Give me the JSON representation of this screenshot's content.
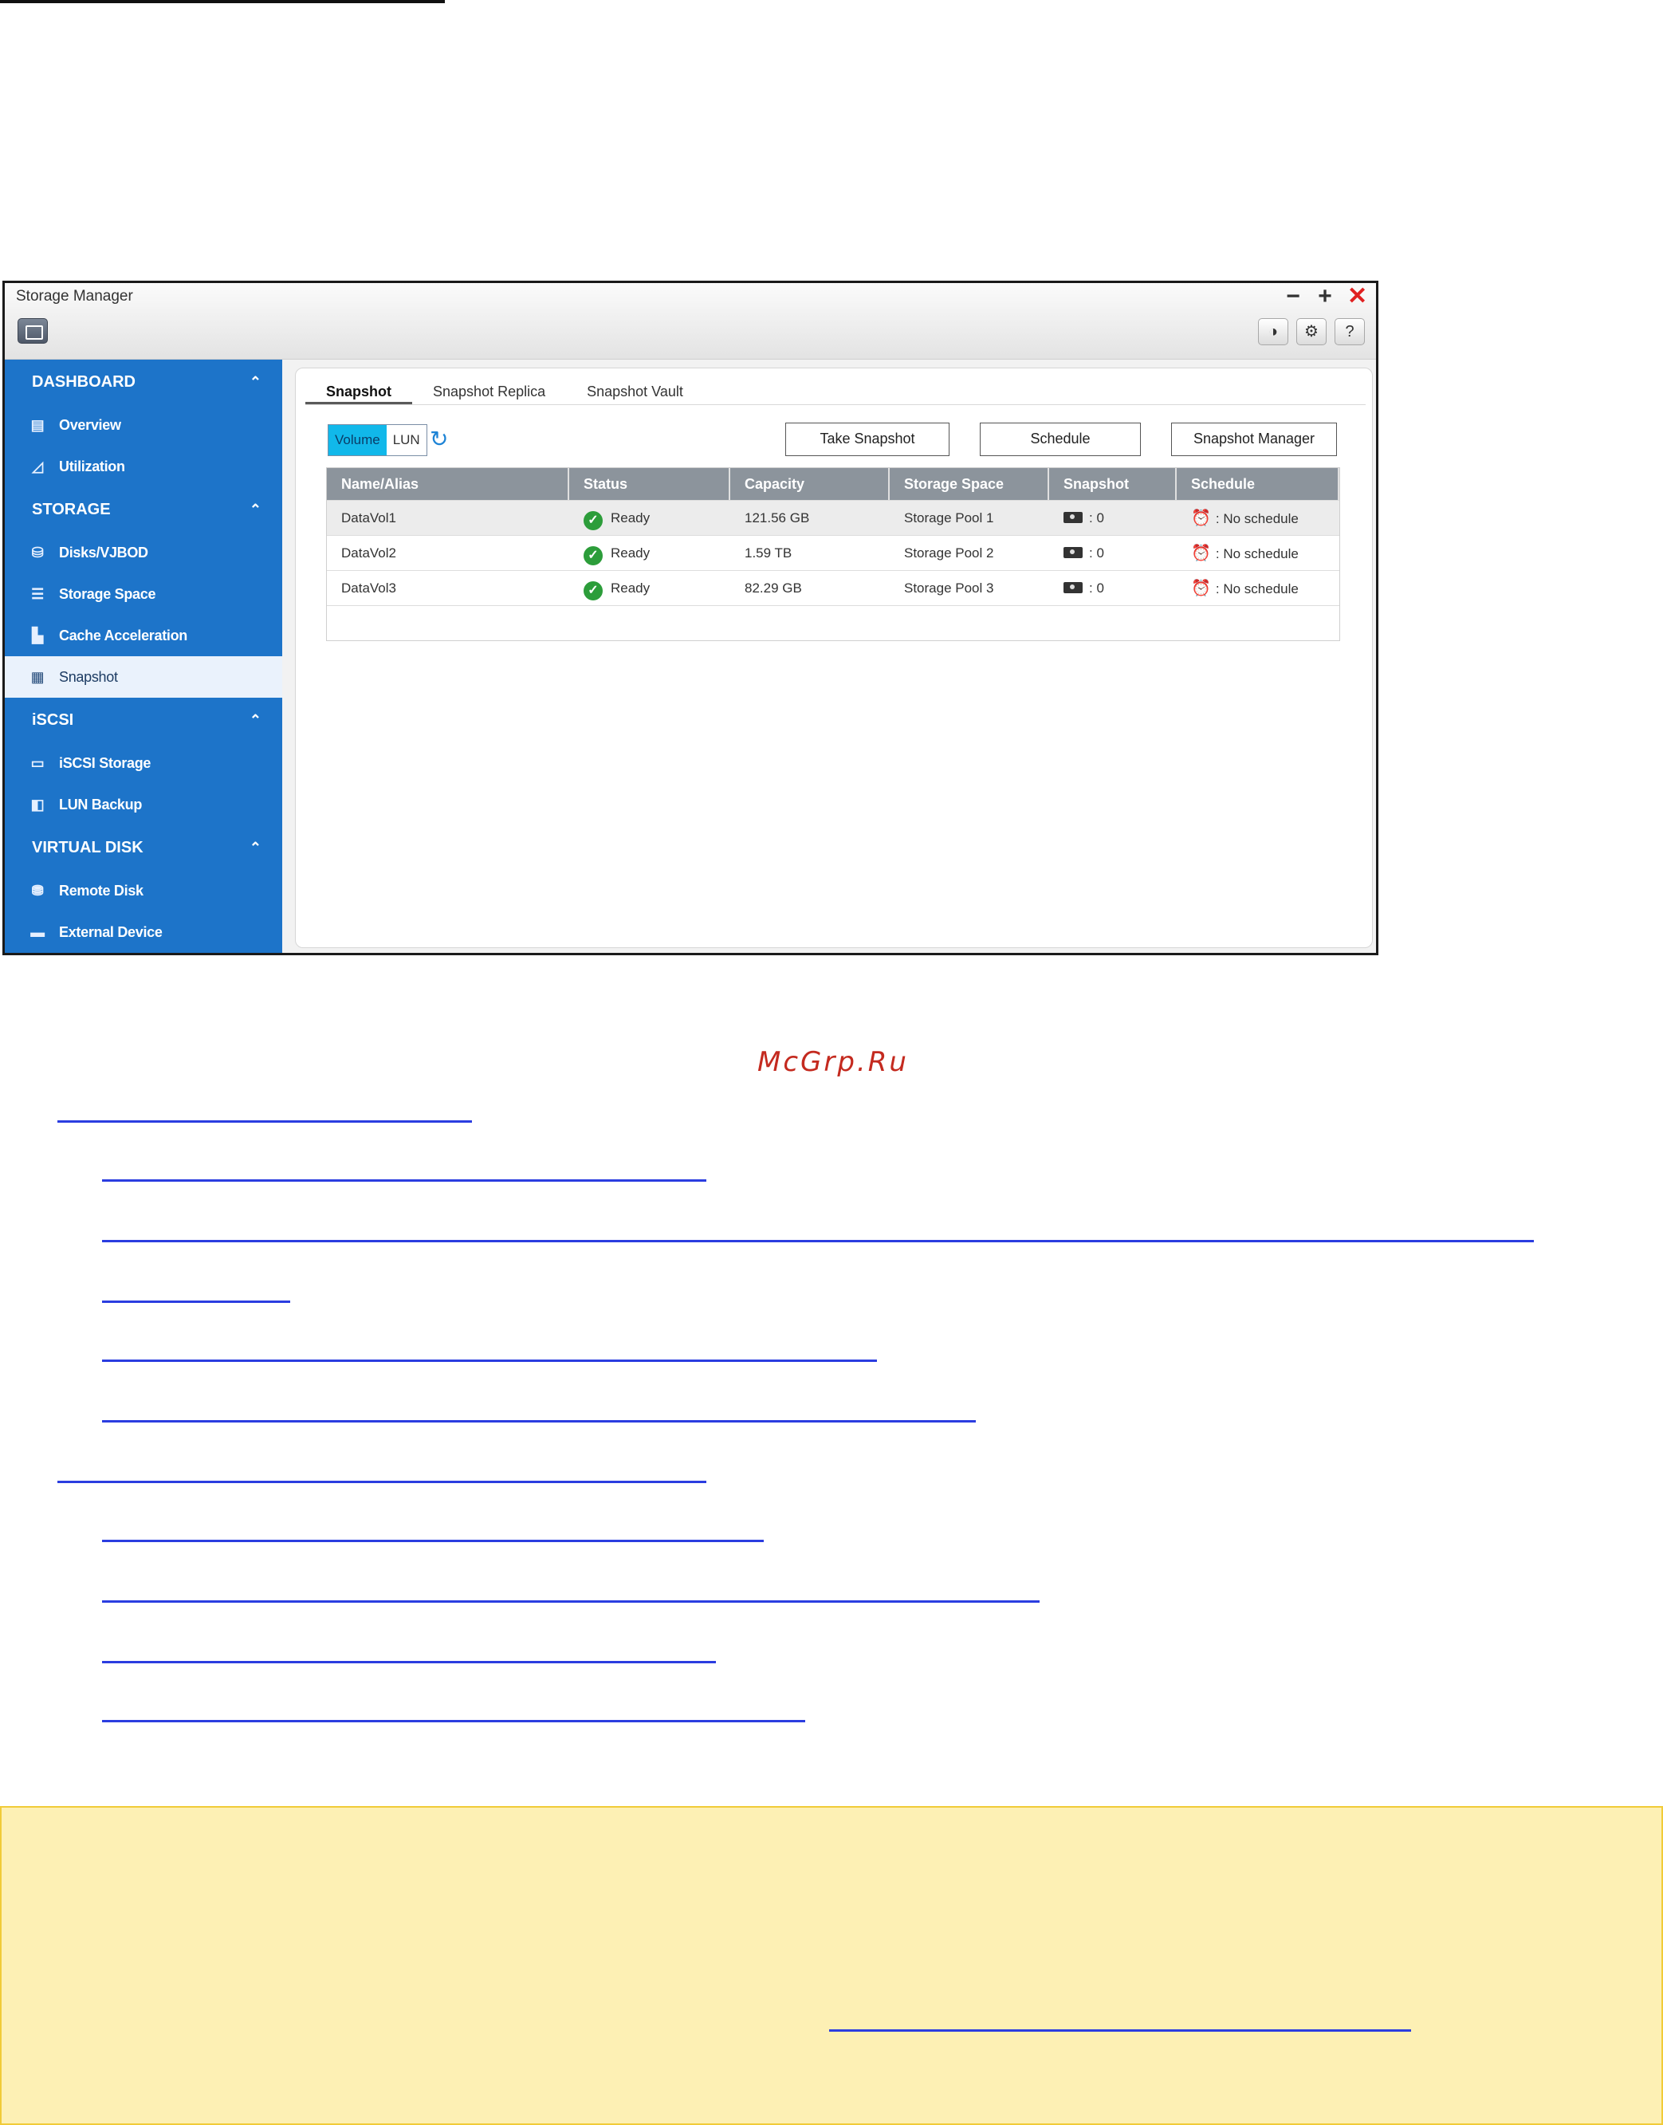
{
  "window": {
    "title": "Storage Manager",
    "controls": {
      "minimize": "−",
      "maximize": "+",
      "close": "✕"
    },
    "toolbar_icons": [
      "◑",
      "⚙",
      "?"
    ]
  },
  "sidebar": {
    "sections": [
      {
        "title": "DASHBOARD",
        "items": [
          "Overview",
          "Utilization"
        ]
      },
      {
        "title": "STORAGE",
        "items": [
          "Disks/VJBOD",
          "Storage Space",
          "Cache Acceleration",
          "Snapshot"
        ]
      },
      {
        "title": "iSCSI",
        "items": [
          "iSCSI Storage",
          "LUN Backup"
        ]
      },
      {
        "title": "VIRTUAL DISK",
        "items": [
          "Remote Disk",
          "External Device"
        ]
      }
    ],
    "active_item": "Snapshot"
  },
  "tabs": [
    "Snapshot",
    "Snapshot Replica",
    "Snapshot Vault"
  ],
  "toggle": {
    "volume": "Volume",
    "lun": "LUN"
  },
  "buttons": {
    "take_snapshot": "Take Snapshot",
    "schedule": "Schedule",
    "snapshot_manager": "Snapshot Manager"
  },
  "table": {
    "columns": [
      "Name/Alias",
      "Status",
      "Capacity",
      "Storage Space",
      "Snapshot",
      "Schedule"
    ],
    "rows": [
      {
        "name": "DataVol1",
        "status": "Ready",
        "capacity": "121.56 GB",
        "space": "Storage Pool 1",
        "snapshot": ": 0",
        "schedule": ": No schedule"
      },
      {
        "name": "DataVol2",
        "status": "Ready",
        "capacity": "1.59 TB",
        "space": "Storage Pool 2",
        "snapshot": ": 0",
        "schedule": ": No schedule"
      },
      {
        "name": "DataVol3",
        "status": "Ready",
        "capacity": "82.29 GB",
        "space": "Storage Pool 3",
        "snapshot": ": 0",
        "schedule": ": No schedule"
      }
    ]
  },
  "watermark": "McGrp.Ru",
  "colors": {
    "sidebar": "#1d74c9",
    "active_toggle": "#11b8ea",
    "link": "#2b3de0",
    "note_bg": "#fdf0b4",
    "ready": "#2c9d3a"
  }
}
